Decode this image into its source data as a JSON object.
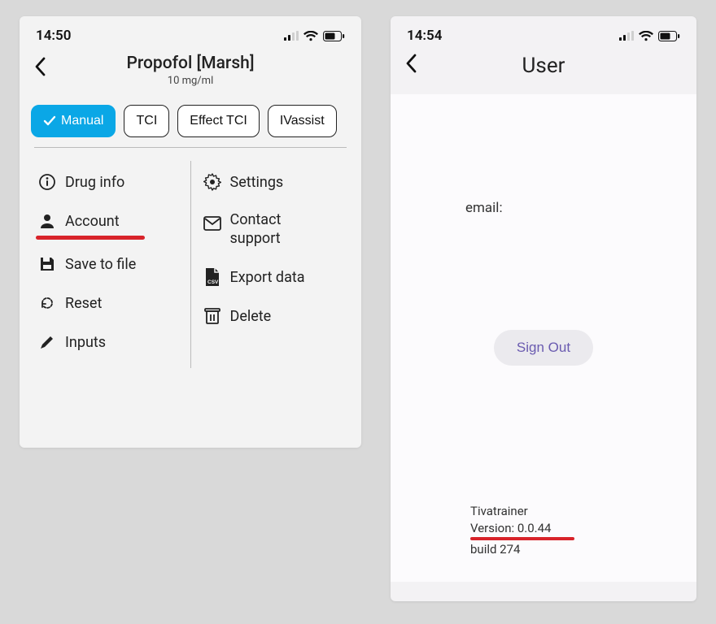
{
  "left": {
    "status_time": "14:50",
    "title": "Propofol [Marsh]",
    "subtitle": "10 mg/ml",
    "segments": {
      "manual": "Manual",
      "tci": "TCI",
      "effect_tci": "Effect TCI",
      "ivassist": "IVassist"
    },
    "menu": {
      "drug_info": "Drug info",
      "account": "Account",
      "save_to_file": "Save to file",
      "reset": "Reset",
      "inputs": "Inputs",
      "settings": "Settings",
      "contact_support": "Contact support",
      "export_data": "Export data",
      "delete": "Delete"
    }
  },
  "right": {
    "status_time": "14:54",
    "title": "User",
    "email_label": "email:",
    "sign_out": "Sign Out",
    "app_name": "Tivatrainer",
    "version_line": "Version: 0.0.44",
    "build_line": "build 274"
  }
}
